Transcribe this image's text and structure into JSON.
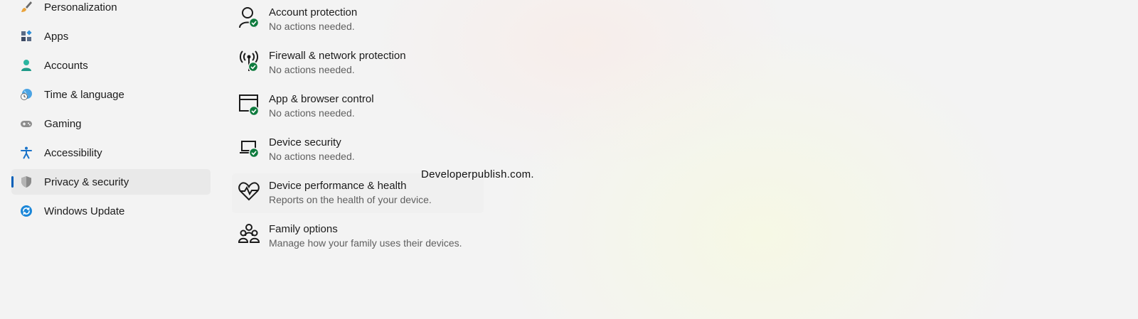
{
  "sidebar": {
    "items": [
      {
        "label": "Personalization",
        "icon": "paintbrush-icon"
      },
      {
        "label": "Apps",
        "icon": "apps-icon"
      },
      {
        "label": "Accounts",
        "icon": "person-icon"
      },
      {
        "label": "Time & language",
        "icon": "globe-clock-icon"
      },
      {
        "label": "Gaming",
        "icon": "gamepad-icon"
      },
      {
        "label": "Accessibility",
        "icon": "accessibility-icon"
      },
      {
        "label": "Privacy & security",
        "icon": "shield-icon",
        "selected": true
      },
      {
        "label": "Windows Update",
        "icon": "refresh-icon"
      }
    ]
  },
  "main": {
    "areas": [
      {
        "title": "Account protection",
        "subtitle": "No actions needed.",
        "icon": "person-check-icon",
        "status": "ok"
      },
      {
        "title": "Firewall & network protection",
        "subtitle": "No actions needed.",
        "icon": "antenna-check-icon",
        "status": "ok"
      },
      {
        "title": "App & browser control",
        "subtitle": "No actions needed.",
        "icon": "browser-window-check-icon",
        "status": "ok"
      },
      {
        "title": "Device security",
        "subtitle": "No actions needed.",
        "icon": "laptop-check-icon",
        "status": "ok"
      },
      {
        "title": "Device performance & health",
        "subtitle": "Reports on the health of your device.",
        "icon": "heart-pulse-icon"
      },
      {
        "title": "Family options",
        "subtitle": "Manage how your family uses their devices.",
        "icon": "family-icon"
      }
    ]
  },
  "watermark": "Developerpublish.com.",
  "colors": {
    "accent": "#005fb8",
    "status_ok": "#0f7b3e",
    "selected_bg": "#e9e9e9",
    "window_bg": "#f3f3f3"
  }
}
